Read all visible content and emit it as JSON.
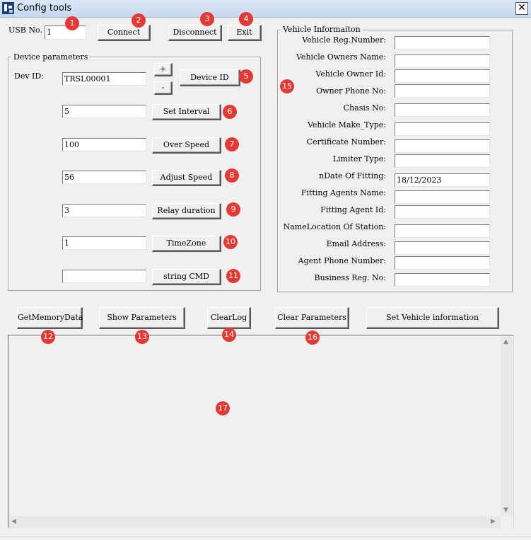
{
  "window": {
    "title": "Config tools",
    "close_glyph": "✕"
  },
  "connection": {
    "usb_label": "USB No. :",
    "usb_value": "1",
    "connect_label": "Connect",
    "disconnect_label": "Disconnect",
    "exit_label": "Exit"
  },
  "device": {
    "group_title": "Device parameters",
    "dev_id_label": "Dev ID:",
    "dev_id_value": "TRSL00001",
    "plus_label": "+",
    "minus_label": "-",
    "device_id_button": "Device ID",
    "interval_value": "5",
    "interval_button": "Set Interval",
    "overspeed_value": "100",
    "overspeed_button": "Over Speed",
    "adjust_value": "56",
    "adjust_button": "Adjust Speed",
    "relay_value": "3",
    "relay_button": "Relay duration",
    "timezone_value": "1",
    "timezone_button": "TimeZone",
    "cmd_value": "",
    "cmd_button": "string CMD"
  },
  "vehicle": {
    "group_title": "Vehicle Informaiton",
    "fields": [
      {
        "label": "Vehicle Reg.Number:",
        "value": ""
      },
      {
        "label": "Vehicle Owners Name:",
        "value": ""
      },
      {
        "label": "Vehicle Owner Id:",
        "value": ""
      },
      {
        "label": "Owner Phone No:",
        "value": ""
      },
      {
        "label": "Chasis No:",
        "value": ""
      },
      {
        "label": "Vehicle Make_Type:",
        "value": ""
      },
      {
        "label": "Certificate Number:",
        "value": ""
      },
      {
        "label": "Limiter Type:",
        "value": ""
      },
      {
        "label": "nDate Of Fitting:",
        "value": "18/12/2023"
      },
      {
        "label": "Fitting Agents Name:",
        "value": ""
      },
      {
        "label": "Fitting Agent Id:",
        "value": ""
      },
      {
        "label": "NameLocation Of Station:",
        "value": ""
      },
      {
        "label": "Email Address:",
        "value": ""
      },
      {
        "label": "Agent Phone Number:",
        "value": ""
      },
      {
        "label": "Business Reg. No:",
        "value": ""
      }
    ]
  },
  "actions": {
    "get_memory": "GetMemoryData",
    "show_params": "Show Parameters",
    "clear_log": "ClearLog",
    "clear_params": "Clear Parameters",
    "set_vehicle": "Set Vehicle information"
  },
  "scroll": {
    "up": "▲",
    "down": "▼",
    "left": "◀",
    "right": "▶"
  },
  "badges": [
    "1",
    "2",
    "3",
    "4",
    "5",
    "6",
    "7",
    "8",
    "9",
    "10",
    "11",
    "12",
    "13",
    "14",
    "15",
    "16",
    "17"
  ],
  "colors": {
    "badge": "#e53935",
    "titlebar": "#dbe7f7",
    "window_bg": "#f0f0f0"
  }
}
